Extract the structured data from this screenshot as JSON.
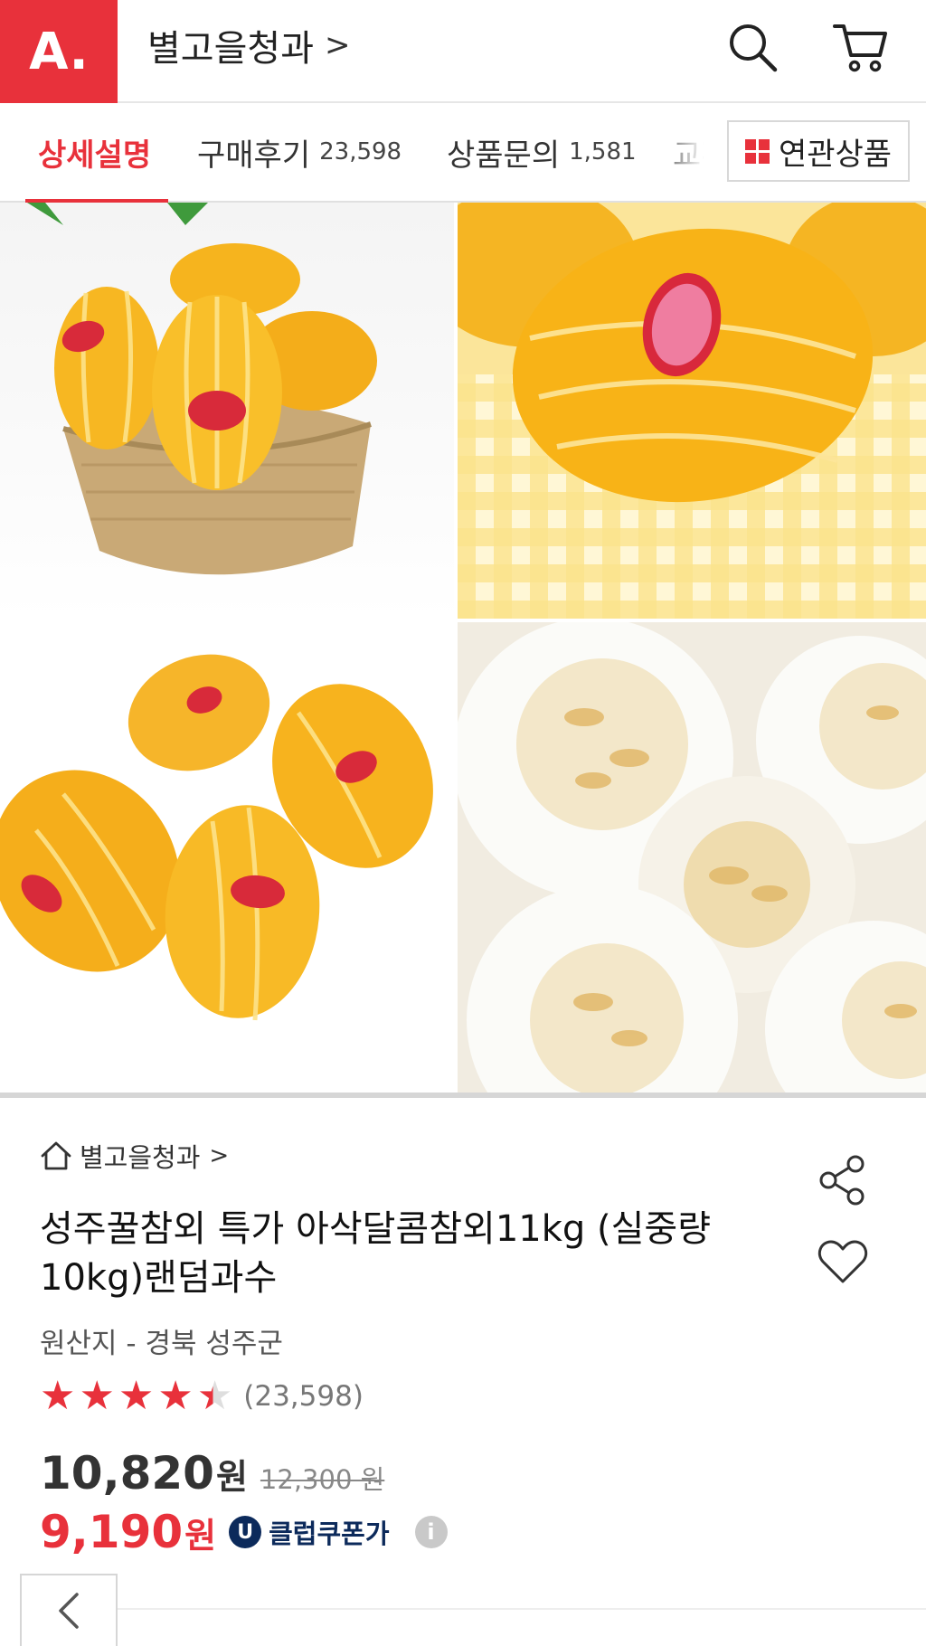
{
  "header": {
    "logo_text": "A.",
    "store_name": "별고을청과",
    "store_chevron": ">",
    "brand_color": "#e8313b"
  },
  "tabs": [
    {
      "label": "상세설명",
      "count": "",
      "active": true
    },
    {
      "label": "구매후기",
      "count": "23,598",
      "active": false
    },
    {
      "label": "상품문의",
      "count": "1,581",
      "active": false
    },
    {
      "label": "교환",
      "count": "",
      "active": false
    }
  ],
  "related_button": {
    "label": "연관상품",
    "icon": "grid-icon"
  },
  "gallery": {
    "images": [
      {
        "name": "melons-in-basket"
      },
      {
        "name": "melon-on-gingham"
      },
      {
        "name": "melon-group"
      },
      {
        "name": "sliced-melon-cross-section"
      }
    ]
  },
  "product": {
    "breadcrumb": "별고을청과",
    "breadcrumb_chevron": ">",
    "title": "성주꿀참외 특가 아삭달콤참외11kg (실중량 10kg)랜덤과수",
    "origin": "원산지 - 경북 성주군",
    "rating_value": 4.5,
    "rating_max": 5,
    "review_count": "(23,598)",
    "price": "10,820",
    "price_unit": "원",
    "original_price": "12,300 원",
    "coupon_price": "9,190",
    "coupon_unit": "원",
    "club_badge": "U",
    "club_label": "클럽쿠폰가",
    "info_icon": "i"
  }
}
